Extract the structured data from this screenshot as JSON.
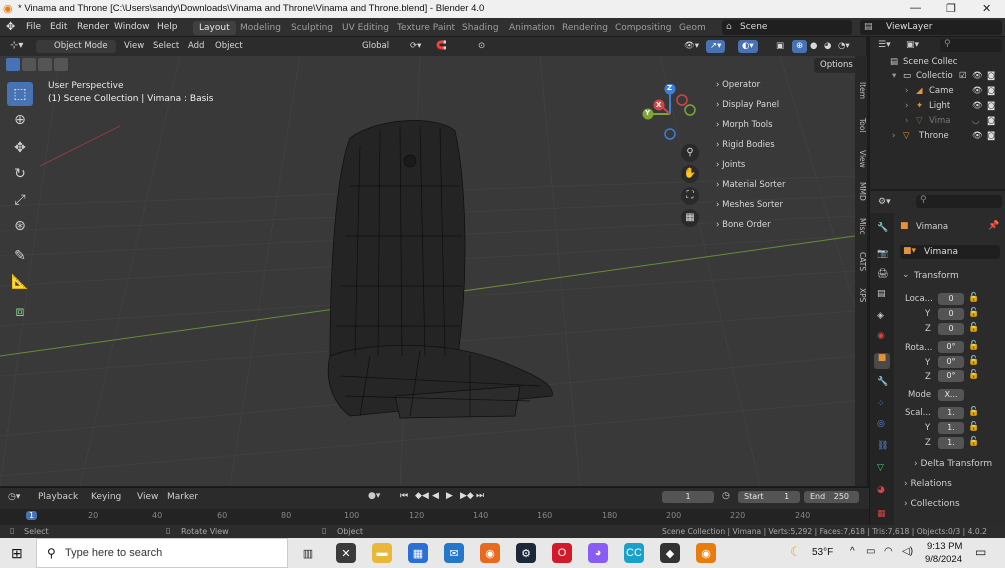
{
  "window": {
    "title": "* Vinama and Throne [C:\\Users\\sandy\\Downloads\\Vinama and Throne\\Vinama and Throne.blend] - Blender 4.0",
    "minimize": "—",
    "maximize": "❐",
    "close": "✕"
  },
  "menu": [
    "File",
    "Edit",
    "Render",
    "Window",
    "Help"
  ],
  "workspaces": [
    "Layout",
    "Modeling",
    "Sculpting",
    "UV Editing",
    "Texture Paint",
    "Shading",
    "Animation",
    "Rendering",
    "Compositing",
    "Geom"
  ],
  "scene": {
    "label": "Scene",
    "view_layer": "ViewLayer"
  },
  "header3d": {
    "mode": "Object Mode",
    "view": "View",
    "select": "Select",
    "add": "Add",
    "object": "Object",
    "transform": "Global",
    "options": "Options"
  },
  "viewport": {
    "perspective": "User Perspective",
    "context": "(1) Scene Collection | Vimana : Basis"
  },
  "gizmo": {
    "z": "Z",
    "y": "Y",
    "x": "X"
  },
  "npanel": [
    "Operator",
    "Display Panel",
    "Morph Tools",
    "Rigid Bodies",
    "Joints",
    "Material Sorter",
    "Meshes Sorter",
    "Bone Order"
  ],
  "ntabs": [
    "Item",
    "Tool",
    "View",
    "MMD",
    "Misc",
    "CATS",
    "XPS"
  ],
  "outliner": {
    "root": "Scene Collec",
    "items": [
      "Collectio",
      "Came",
      "Light",
      "Vima",
      "Throne"
    ]
  },
  "properties": {
    "object_name": "Vimana",
    "data_name": "Vimana",
    "section": "Transform",
    "location_label": "Loca...",
    "rotation_label": "Rota...",
    "scale_label": "Scal...",
    "mode_label": "Mode",
    "axis": [
      "X",
      "Y",
      "Z"
    ],
    "location": [
      "0",
      "0",
      "0"
    ],
    "rotation": [
      "0°",
      "0°",
      "0°"
    ],
    "scale": [
      "1.",
      "1.",
      "1."
    ],
    "mode": "X...",
    "delta": "Delta Transform",
    "relations": "Relations",
    "collections": "Collections"
  },
  "timeline": {
    "playback": "Playback",
    "keying": "Keying",
    "view": "View",
    "marker": "Marker",
    "current": "1",
    "start_label": "Start",
    "start": "1",
    "end_label": "End",
    "end": "250",
    "ruler": [
      "1",
      "20",
      "40",
      "60",
      "80",
      "100",
      "120",
      "140",
      "160",
      "180",
      "200",
      "220",
      "240"
    ]
  },
  "status": {
    "select": "Select",
    "rotate": "Rotate View",
    "object": "Object",
    "stats": "Scene Collection | Vimana | Verts:5,292 | Faces:7,618 | Tris:7,618 | Objects:0/3 | 4.0.2"
  },
  "taskbar": {
    "search": "Type here to search",
    "weather": "53°F",
    "time": "9:13 PM",
    "date": "9/8/2024"
  },
  "colors": {
    "accent": "#4772b3",
    "viewport": "#393939",
    "panel": "#2b2b2b",
    "orange": "#e5923c"
  }
}
